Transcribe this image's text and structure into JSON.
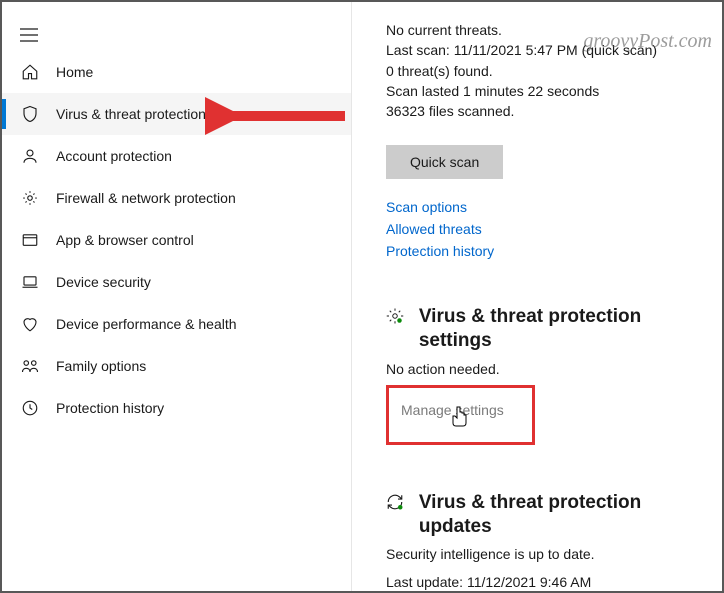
{
  "sidebar": {
    "items": [
      {
        "label": "Home"
      },
      {
        "label": "Virus & threat protection"
      },
      {
        "label": "Account protection"
      },
      {
        "label": "Firewall & network protection"
      },
      {
        "label": "App & browser control"
      },
      {
        "label": "Device security"
      },
      {
        "label": "Device performance & health"
      },
      {
        "label": "Family options"
      },
      {
        "label": "Protection history"
      }
    ]
  },
  "main": {
    "status": {
      "line1": "No current threats.",
      "line2": "Last scan: 11/11/2021 5:47 PM (quick scan)",
      "line3": "0 threat(s) found.",
      "line4": "Scan lasted 1 minutes 22 seconds",
      "line5": "36323 files scanned."
    },
    "quick_scan_label": "Quick scan",
    "links": {
      "scan_options": "Scan options",
      "allowed_threats": "Allowed threats",
      "protection_history": "Protection history"
    },
    "settings_section": {
      "title": "Virus & threat protection settings",
      "subtitle": "No action needed.",
      "manage": "Manage settings"
    },
    "updates_section": {
      "title": "Virus & threat protection updates",
      "subtitle": "Security intelligence is up to date.",
      "last_update": "Last update: 11/12/2021 9:46 AM"
    }
  },
  "watermark": "groovyPost.com"
}
